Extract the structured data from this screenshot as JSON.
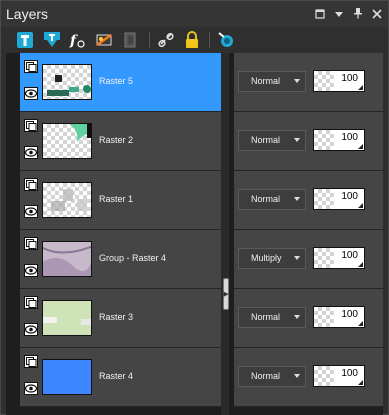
{
  "window": {
    "title": "Layers"
  },
  "window_controls": [
    {
      "name": "restore-window-button",
      "glyph": "▢"
    },
    {
      "name": "menu-button",
      "glyph": "▾"
    },
    {
      "name": "pin-button",
      "glyph": "⊥"
    },
    {
      "name": "close-button",
      "glyph": "✕"
    }
  ],
  "toolbar": {
    "tools": [
      "new-raster-layer-icon",
      "new-vector-layer-icon",
      "new-adjustment-layer-icon",
      "new-mask-layer-icon",
      "layer-group-icon",
      "link-layers-icon",
      "lock-layer-icon",
      "layer-properties-icon"
    ]
  },
  "layers": [
    {
      "name": "Raster 5",
      "blend_mode": "Normal",
      "opacity": "100",
      "selected": true,
      "thumb": "raster5"
    },
    {
      "name": "Raster 2",
      "blend_mode": "Normal",
      "opacity": "100",
      "selected": false,
      "thumb": "raster2"
    },
    {
      "name": "Raster 1",
      "blend_mode": "Normal",
      "opacity": "100",
      "selected": false,
      "thumb": "raster1"
    },
    {
      "name": "Group - Raster 4",
      "blend_mode": "Multiply",
      "opacity": "100",
      "selected": false,
      "thumb": "group"
    },
    {
      "name": "Raster 3",
      "blend_mode": "Normal",
      "opacity": "100",
      "selected": false,
      "thumb": "raster3"
    },
    {
      "name": "Raster 4",
      "blend_mode": "Normal",
      "opacity": "100",
      "selected": false,
      "thumb": "raster4"
    }
  ],
  "colors": {
    "selection": "#3399ff",
    "raster4_fill": "#3d86ff",
    "raster3_fill": "#cfe3b8",
    "accent_teal": "#1f8a6a"
  }
}
